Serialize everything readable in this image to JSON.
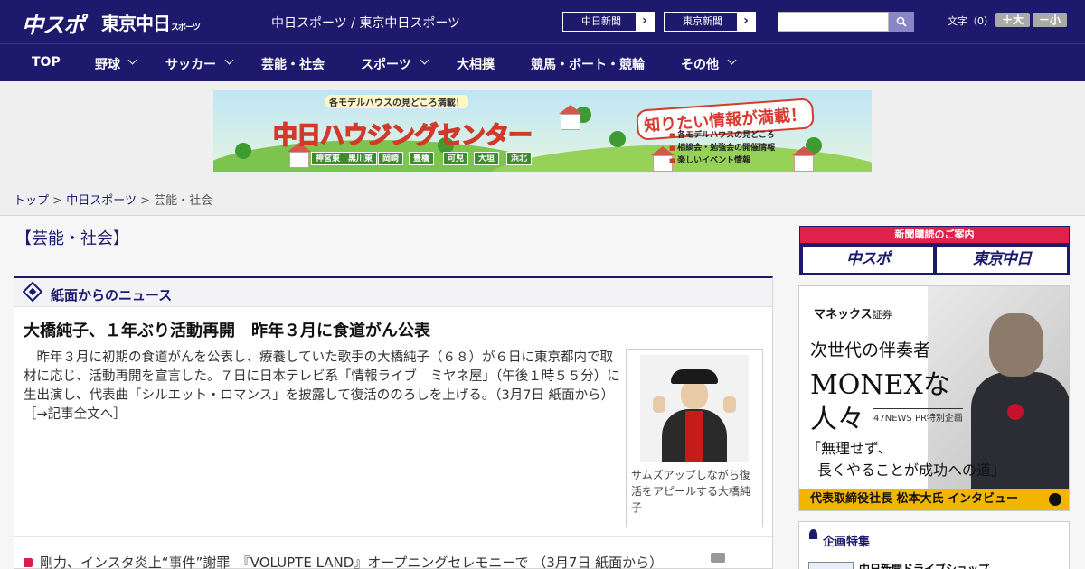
{
  "header": {
    "logo_chunichi": "中スポ",
    "logo_tokyo": "東京中日",
    "logo_tokyo_small": "スポーツ",
    "site_name": "中日スポーツ / 東京中日スポーツ",
    "paper_links": [
      "中日新聞",
      "東京新聞"
    ],
    "search_placeholder": "",
    "font_label": "文字（0）",
    "font_larger": "＋大",
    "font_smaller": "－小"
  },
  "nav": {
    "items": [
      {
        "label": "TOP",
        "has_dropdown": false
      },
      {
        "label": "野球",
        "has_dropdown": true
      },
      {
        "label": "サッカー",
        "has_dropdown": true
      },
      {
        "label": "芸能・社会",
        "has_dropdown": false
      },
      {
        "label": "スポーツ",
        "has_dropdown": true
      },
      {
        "label": "大相撲",
        "has_dropdown": false
      },
      {
        "label": "競馬・ボート・競輪",
        "has_dropdown": false
      },
      {
        "label": "その他",
        "has_dropdown": true
      }
    ]
  },
  "banner": {
    "top_text": "各モデルハウスの見どころ満載！",
    "title": "中日ハウジングセンター",
    "cities": [
      "神宮東",
      "黒川東",
      "岡崎",
      "豊橋",
      "可児",
      "大垣",
      "浜北"
    ],
    "right_title": "知りたい情報が満載！",
    "list": [
      "各モデルハウスの見どころ",
      "相談会・勉強会の開催情報",
      "楽しいイベント情報"
    ]
  },
  "breadcrumb": {
    "items": [
      "トップ",
      "中日スポーツ",
      "芸能・社会"
    ],
    "separator": ">"
  },
  "main": {
    "page_title": "【芸能・社会】",
    "panel_title": "紙面からのニュース",
    "headline": "大橋純子、１年ぶり活動再開　昨年３月に食道がん公表",
    "article_text": "昨年３月に初期の食道がんを公表し、療養していた歌手の大橋純子（６８）が６日に東京都内で取材に応じ、活動再開を宣言した。７日に日本テレビ系「情報ライブ　ミヤネ屋」（午後１時５５分）に生出演し、代表曲「シルエット・ロマンス」を披露して復活ののろしを上げる。（3月7日 紙面から）",
    "read_more": "［→記事全文へ］",
    "photo_caption": "サムズアップしながら復活をアピールする大橋純子",
    "news_items": [
      {
        "text": "剛力、インスタ炎上“事件”謝罪　『VOLUPTE LAND』オープニングセレモニーで （3月7日 紙面から）",
        "has_photo": true
      }
    ]
  },
  "sidebar": {
    "subscribe_title": "新聞購読のご案内",
    "subscribe_logos": [
      "中スポ",
      "東京中日"
    ],
    "ad": {
      "brand": "マネックス",
      "brand_suffix": "証券",
      "line1": "次世代の伴奏者",
      "line2": "MONEXな",
      "line3": "人々",
      "pr_label": "47NEWS PR特別企画",
      "quote1": "「無理せず、",
      "quote2": "長くやることが成功への道」",
      "footer": "代表取締役社長 松本大氏 インタビュー"
    },
    "special_title": "企画特集",
    "special_item": "中日新聞ドライブショップ"
  },
  "colors": {
    "brand_navy": "#1d1a6d",
    "accent_red": "#e0214b",
    "ad_yellow": "#f2b600"
  }
}
